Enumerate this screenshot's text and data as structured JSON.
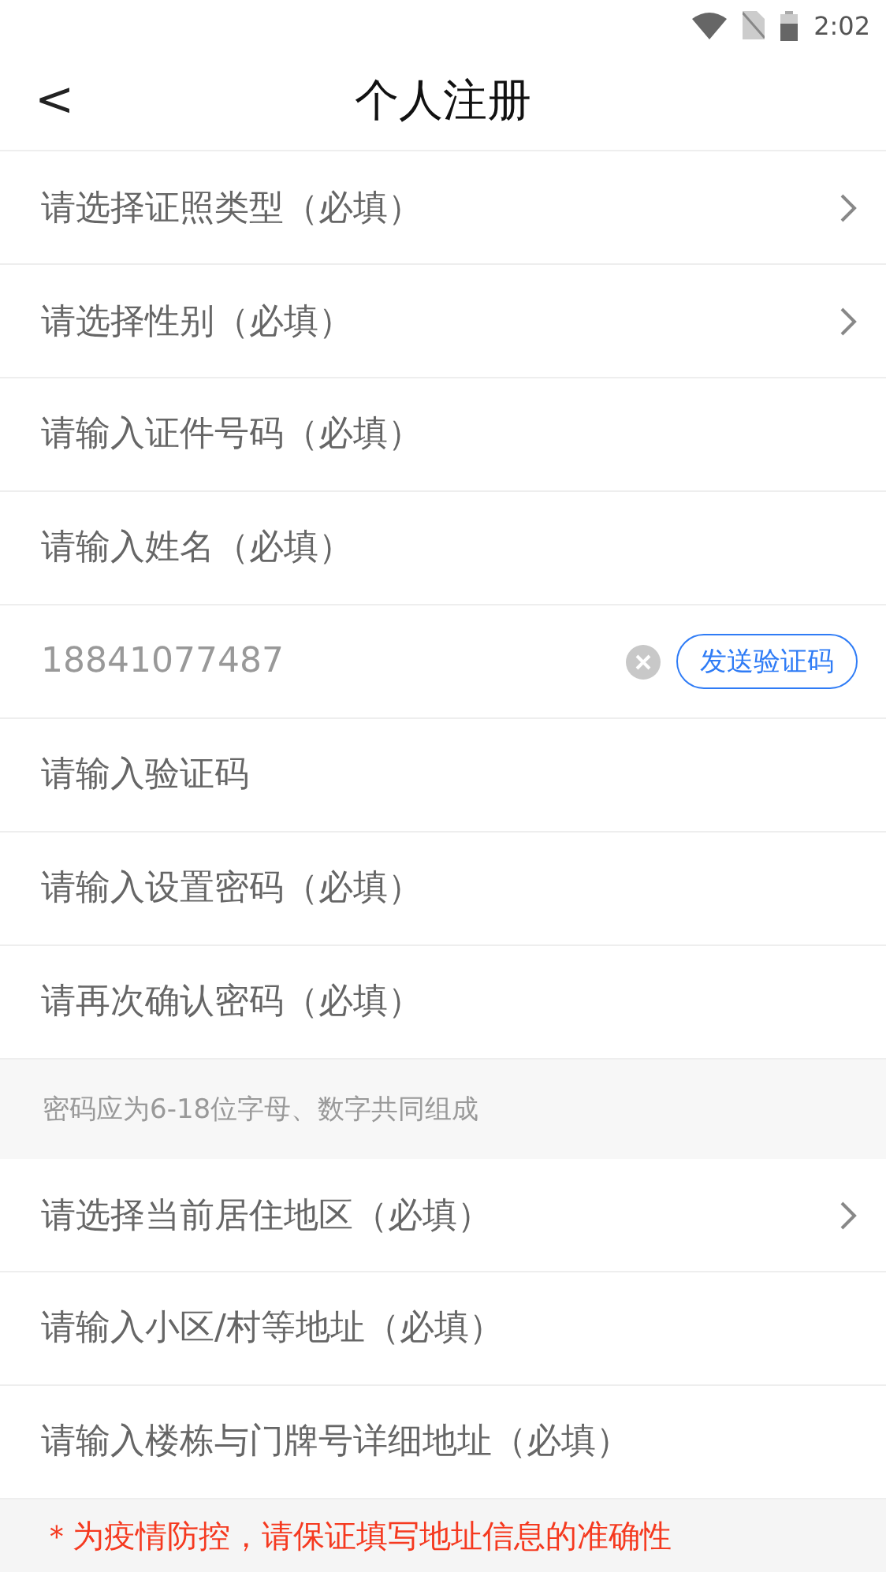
{
  "status_bar": {
    "time": "2:02"
  },
  "header": {
    "title": "个人注册",
    "back": "<"
  },
  "fields": [
    {
      "kind": "select",
      "placeholder": "请选择证照类型（必填）"
    },
    {
      "kind": "select",
      "placeholder": "请选择性别（必填）"
    },
    {
      "kind": "input",
      "placeholder": "请输入证件号码（必填）"
    },
    {
      "kind": "input",
      "placeholder": "请输入姓名（必填）"
    },
    {
      "kind": "phone",
      "value": "18841077487",
      "button": "发送验证码"
    },
    {
      "kind": "input",
      "placeholder": "请输入验证码"
    },
    {
      "kind": "input",
      "placeholder": "请输入设置密码（必填）"
    },
    {
      "kind": "input",
      "placeholder": "请再次确认密码（必填）"
    },
    {
      "kind": "note",
      "text": "密码应为6-18位字母、数字共同组成"
    },
    {
      "kind": "select",
      "placeholder": "请选择当前居住地区（必填）"
    },
    {
      "kind": "input",
      "placeholder": "请输入小区/村等地址（必填）"
    },
    {
      "kind": "input",
      "placeholder": "请输入楼栋与门牌号详细地址（必填）"
    }
  ],
  "notice": "＊为疫情防控，请保证填写地址信息的准确性"
}
